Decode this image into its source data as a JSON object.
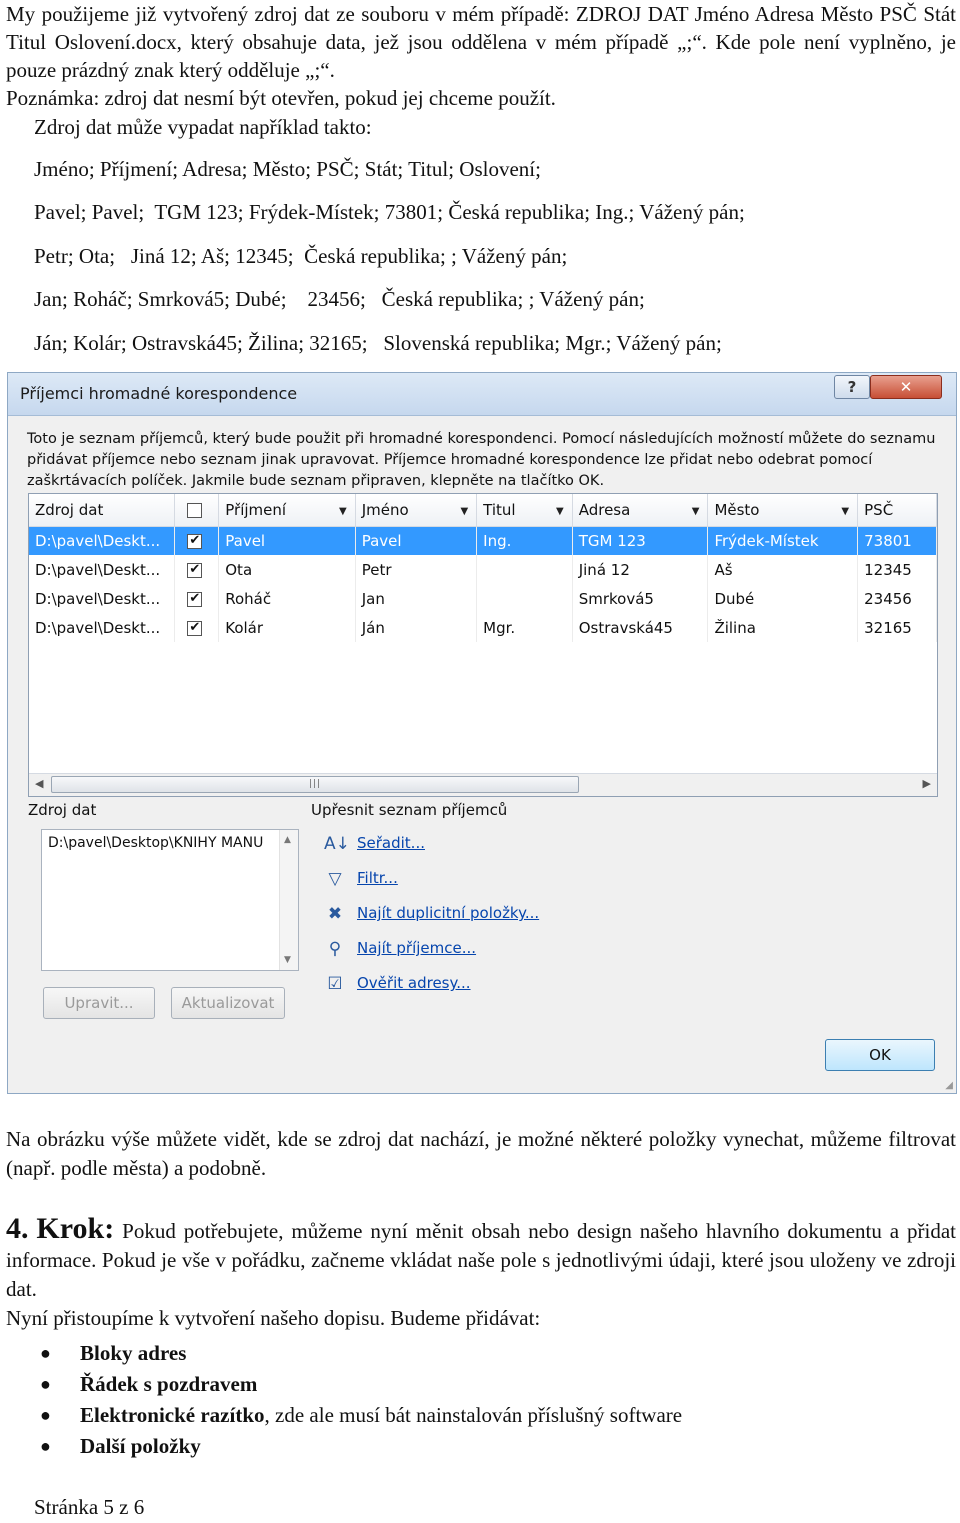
{
  "intro": {
    "line1": "My použijeme již vytvořený zdroj dat ze souboru v mém případě: ZDROJ DAT Jméno Adresa Město PSČ Stát Titul Oslovení.docx, který obsahuje data, jež jsou oddělena v mém případě „;“. Kde pole není vyplněno, je pouze prázdný znak který odděluje „;“.",
    "line2": "Poznámka: zdroj dat nesmí být otevřen, pokud jej chceme použít."
  },
  "example": {
    "title": "Zdroj dat může vypadat například takto:",
    "rows": [
      "Jméno; Příjmení; Adresa; Město; PSČ; Stát; Titul; Oslovení;",
      "Pavel; Pavel;  TGM 123; Frýdek-Místek; 73801; Česká republika; Ing.; Vážený pán;",
      "Petr; Ota;   Jiná 12; Aš; 12345;  Česká republika; ; Vážený pán;",
      "Jan; Roháč; Smrková5; Dubé;    23456;   Česká republika; ; Vážený pán;",
      "Ján; Kolár; Ostravská45; Žilina; 32165;   Slovenská republika; Mgr.; Vážený pán;"
    ]
  },
  "dialog": {
    "title": "Příjemci hromadné korespondence",
    "help_label": "?",
    "close_label": "✕",
    "description": "Toto je seznam příjemců, který bude použit při hromadné korespondenci. Pomocí následujících možností můžete do seznamu přidávat příjemce nebo seznam jinak upravovat. Příjemce hromadné korespondence lze přidat nebo odebrat pomocí zaškrtávacích políček. Jakmile bude seznam připraven, klepněte na tlačítko OK.",
    "columns": [
      "Zdroj dat",
      "",
      "Příjmení",
      "Jméno",
      "Titul",
      "Adresa",
      "Město",
      "PSČ"
    ],
    "rows": [
      {
        "source": "D:\\pavel\\Deskt...",
        "checked": "✔",
        "surname": "Pavel",
        "name": "Pavel",
        "title": "Ing.",
        "address": "TGM 123",
        "city": "Frýdek-Místek",
        "zip": "73801"
      },
      {
        "source": "D:\\pavel\\Deskt...",
        "checked": "✔",
        "surname": "Ota",
        "name": "Petr",
        "title": "",
        "address": "Jiná 12",
        "city": "Aš",
        "zip": "12345"
      },
      {
        "source": "D:\\pavel\\Deskt...",
        "checked": "✔",
        "surname": "Roháč",
        "name": "Jan",
        "title": "",
        "address": "Smrková5",
        "city": "Dubé",
        "zip": "23456"
      },
      {
        "source": "D:\\pavel\\Deskt...",
        "checked": "✔",
        "surname": "Kolár",
        "name": "Ján",
        "title": "Mgr.",
        "address": "Ostravská45",
        "city": "Žilina",
        "zip": "32165"
      }
    ],
    "selected_row": 0,
    "source_label": "Zdroj dat",
    "source_item": "D:\\pavel\\Desktop\\KNIHY MANU",
    "refine_label": "Upřesnit seznam příjemců",
    "refine_items": [
      {
        "label": "Seřadit...",
        "icon": "sort-icon",
        "glyph": "A↓"
      },
      {
        "label": "Filtr...",
        "icon": "filter-icon",
        "glyph": "▽"
      },
      {
        "label": "Najít duplicitní položky...",
        "icon": "duplicates-icon",
        "glyph": "✖"
      },
      {
        "label": "Najít příjemce...",
        "icon": "find-recipient-icon",
        "glyph": "⚲"
      },
      {
        "label": "Ověřit adresy...",
        "icon": "validate-icon",
        "glyph": "☑"
      }
    ],
    "edit_label": "Upravit...",
    "refresh_label": "Aktualizovat",
    "ok_label": "OK"
  },
  "after_dialog": "Na obrázku výše můžete vidět, kde se zdroj dat nachází, je možné některé položky vynechat, můžeme filtrovat (např. podle města) a podobně.",
  "step": {
    "number": "4.",
    "word": "Krok:",
    "text": "Pokud potřebujete, můžeme nyní měnit obsah nebo design našeho hlavního dokumentu a přidat informace. Pokud je vše v pořádku, začneme vkládat naše pole s jednotlivými údaji, které jsou uloženy ve zdroji dat.",
    "next": "Nyní přistoupíme k vytvoření našeho dopisu. Budeme přidávat:"
  },
  "bullets": [
    {
      "bold": "Bloky adres",
      "rest": ""
    },
    {
      "bold": "Řádek s pozdravem",
      "rest": ""
    },
    {
      "bold": "Elektronické razítko",
      "rest": ", zde ale musí bát nainstalován příslušný software"
    },
    {
      "bold": "Další položky",
      "rest": ""
    }
  ],
  "footer": "Stránka 5 z 6"
}
